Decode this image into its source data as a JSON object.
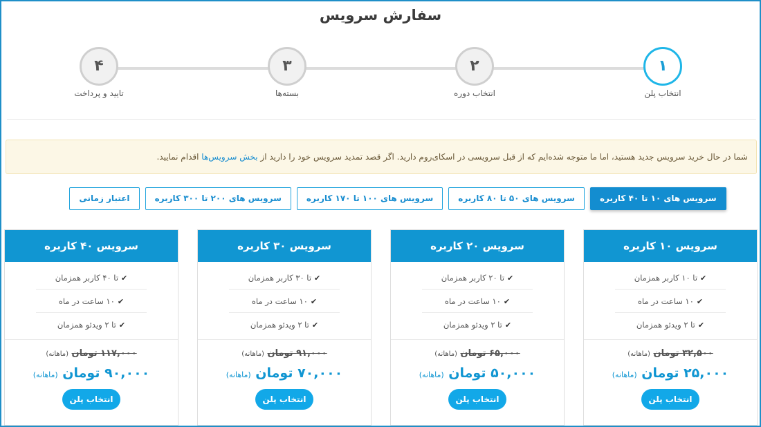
{
  "page": {
    "title": "سفارش سرویس"
  },
  "steps": [
    {
      "number": "۱",
      "label": "انتخاب پلن"
    },
    {
      "number": "۲",
      "label": "انتخاب دوره"
    },
    {
      "number": "۳",
      "label": "بسته‌ها"
    },
    {
      "number": "۴",
      "label": "تایید و پرداخت"
    }
  ],
  "active_step": 1,
  "alert": {
    "text_before": "شما در حال خرید سرویس جدید هستید، اما ما متوجه شده‌ایم که از قبل سرویسی در اسکای‌روم دارید. اگر قصد تمدید سرویس خود را دارید از",
    "link_text": "بخش سرویس‌ها",
    "text_after": "اقدام نمایید."
  },
  "filters": [
    {
      "label": "سرویس های ۱۰ تا ۴۰ کاربره",
      "active": true
    },
    {
      "label": "سرویس های ۵۰ تا ۸۰ کاربره",
      "active": false
    },
    {
      "label": "سرویس های ۱۰۰ تا ۱۷۰ کاربره",
      "active": false
    },
    {
      "label": "سرویس های ۲۰۰ تا ۳۰۰ کاربره",
      "active": false
    },
    {
      "label": "اعتبار زمانی",
      "active": false
    }
  ],
  "plans": [
    {
      "title": "سرویس ۱۰ کاربره",
      "features": [
        "تا ۱۰ کاربر همزمان",
        "۱۰ ساعت در ماه",
        "تا ۲ ویدئو همزمان"
      ],
      "old_price": "۳۲,۵۰۰ تومان",
      "old_period": "(ماهانه)",
      "new_price": "۲۵,۰۰۰ تومان",
      "new_period": "(ماهانه)",
      "button": "انتخاب پلن"
    },
    {
      "title": "سرویس ۲۰ کاربره",
      "features": [
        "تا ۲۰ کاربر همزمان",
        "۱۰ ساعت در ماه",
        "تا ۲ ویدئو همزمان"
      ],
      "old_price": "۶۵,۰۰۰ تومان",
      "old_period": "(ماهانه)",
      "new_price": "۵۰,۰۰۰ تومان",
      "new_period": "(ماهانه)",
      "button": "انتخاب پلن"
    },
    {
      "title": "سرویس ۳۰ کاربره",
      "features": [
        "تا ۳۰ کاربر همزمان",
        "۱۰ ساعت در ماه",
        "تا ۲ ویدئو همزمان"
      ],
      "old_price": "۹۱,۰۰۰ تومان",
      "old_period": "(ماهانه)",
      "new_price": "۷۰,۰۰۰ تومان",
      "new_period": "(ماهانه)",
      "button": "انتخاب پلن"
    },
    {
      "title": "سرویس ۴۰ کاربره",
      "features": [
        "تا ۴۰ کاربر همزمان",
        "۱۰ ساعت در ماه",
        "تا ۲ ویدئو همزمان"
      ],
      "old_price": "۱۱۷,۰۰۰ تومان",
      "old_period": "(ماهانه)",
      "new_price": "۹۰,۰۰۰ تومان",
      "new_period": "(ماهانه)",
      "button": "انتخاب پلن"
    }
  ],
  "colors": {
    "accent": "#1196d2",
    "button": "#12a8e8",
    "active_step_border": "#1fb6e8",
    "alert_bg": "#fcf7e6"
  },
  "icons": {
    "feature": "check-icon"
  }
}
